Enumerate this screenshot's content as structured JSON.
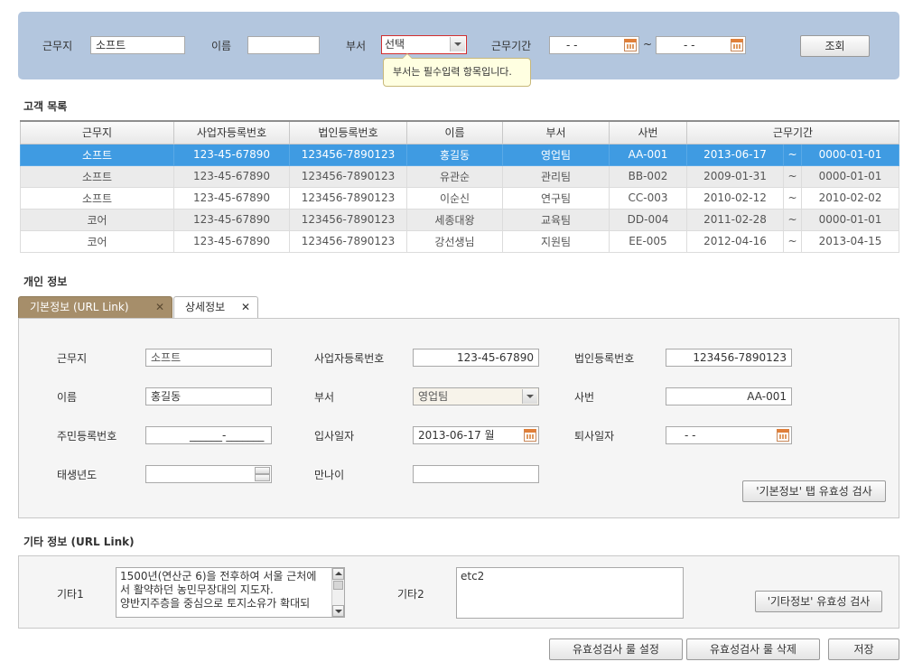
{
  "search": {
    "workplace_label": "근무지",
    "workplace_value": "소프트",
    "name_label": "이름",
    "name_value": "",
    "dept_label": "부서",
    "dept_value": "선택",
    "period_label": "근무기간",
    "period_from": "- -",
    "period_sep": "~",
    "period_to": "- -",
    "search_button": "조회",
    "tooltip": "부서는 필수입력 항목입니다."
  },
  "customer_list": {
    "title": "고객 목록",
    "columns": [
      "근무지",
      "사업자등록번호",
      "법인등록번호",
      "이름",
      "부서",
      "사번",
      "근무기간"
    ],
    "rows": [
      {
        "workplace": "소프트",
        "biz_no": "123-45-67890",
        "corp_no": "123456-7890123",
        "name": "홍길동",
        "dept": "영업팀",
        "emp_no": "AA-001",
        "from": "2013-06-17",
        "sep": "~",
        "to": "0000-01-01"
      },
      {
        "workplace": "소프트",
        "biz_no": "123-45-67890",
        "corp_no": "123456-7890123",
        "name": "유관순",
        "dept": "관리팀",
        "emp_no": "BB-002",
        "from": "2009-01-31",
        "sep": "~",
        "to": "0000-01-01"
      },
      {
        "workplace": "소프트",
        "biz_no": "123-45-67890",
        "corp_no": "123456-7890123",
        "name": "이순신",
        "dept": "연구팀",
        "emp_no": "CC-003",
        "from": "2010-02-12",
        "sep": "~",
        "to": "2010-02-02"
      },
      {
        "workplace": "코어",
        "biz_no": "123-45-67890",
        "corp_no": "123456-7890123",
        "name": "세종대왕",
        "dept": "교육팀",
        "emp_no": "DD-004",
        "from": "2011-02-28",
        "sep": "~",
        "to": "0000-01-01"
      },
      {
        "workplace": "코어",
        "biz_no": "123-45-67890",
        "corp_no": "123456-7890123",
        "name": "강선생님",
        "dept": "지원팀",
        "emp_no": "EE-005",
        "from": "2012-04-16",
        "sep": "~",
        "to": "2013-04-15"
      }
    ]
  },
  "personal": {
    "title": "개인 정보",
    "tabs": [
      {
        "label": "기본정보 (URL Link)",
        "close": "✕"
      },
      {
        "label": "상세정보",
        "close": "✕"
      }
    ],
    "workplace_label": "근무지",
    "workplace_value": "소프트",
    "biz_no_label": "사업자등록번호",
    "biz_no_value": "123-45-67890",
    "corp_no_label": "법인등록번호",
    "corp_no_value": "123456-7890123",
    "name_label": "이름",
    "name_value": "홍길동",
    "dept_label": "부서",
    "dept_value": "영업팀",
    "emp_no_label": "사번",
    "emp_no_value": "AA-001",
    "rrn_label": "주민등록번호",
    "rrn_value": "______-_______",
    "join_label": "입사일자",
    "join_value": "2013-06-17 월",
    "leave_label": "퇴사일자",
    "leave_value": "- -",
    "birth_year_label": "태생년도",
    "birth_year_value": "",
    "age_label": "만나이",
    "age_value": "",
    "validate_button": "'기본정보' 탭 유효성 검사"
  },
  "etc": {
    "title": "기타 정보 (URL Link)",
    "etc1_label": "기타1",
    "etc1_lines": [
      "1500년(연산군 6)을 전후하여 서울 근처에",
      "서 활약하던 농민무장대의 지도자.",
      "양반지주층을 중심으로 토지소유가 확대되"
    ],
    "etc2_label": "기타2",
    "etc2_value": "etc2",
    "validate_button": "'기타정보' 유효성 검사"
  },
  "footer": {
    "set_rules_button": "유효성검사 룰 설정",
    "delete_rules_button": "유효성검사 룰 삭제",
    "save_button": "저장"
  },
  "colors": {
    "search_panel_bg": "#b3c6de",
    "selected_row": "#3f9be2",
    "active_tab": "#a68e6a",
    "required_border": "#d22f2f",
    "tooltip_bg": "#ffffe1"
  }
}
